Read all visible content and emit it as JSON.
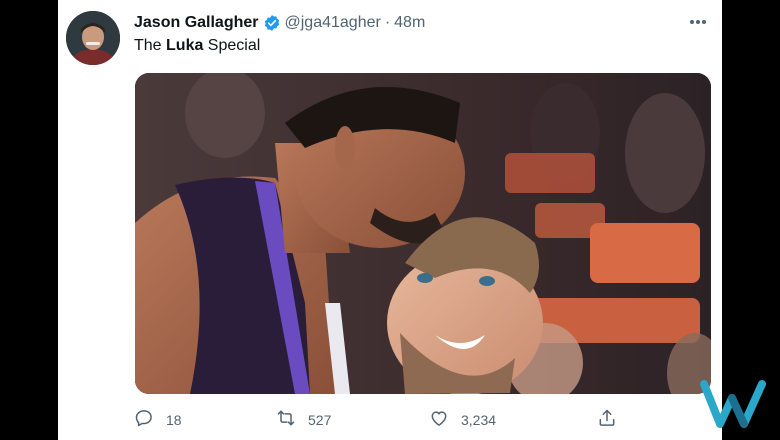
{
  "tweet": {
    "author_name": "Jason Gallagher",
    "handle": "@jga41agher",
    "separator": "·",
    "time": "48m",
    "text_before": "The ",
    "text_bold": "Luka",
    "text_after": " Special"
  },
  "actions": {
    "replies": "18",
    "retweets": "527",
    "likes": "3,234"
  },
  "icons": {
    "verified": "verified-badge-icon",
    "more": "more-options-icon",
    "reply": "reply-icon",
    "retweet": "retweet-icon",
    "like": "heart-icon",
    "share": "share-icon",
    "watermark": "w-logo-icon"
  },
  "colors": {
    "verified_blue": "#1d9bf0",
    "secondary_text": "#536471",
    "primary_text": "#0f1419",
    "watermark_teal": "#2aa7c9"
  }
}
